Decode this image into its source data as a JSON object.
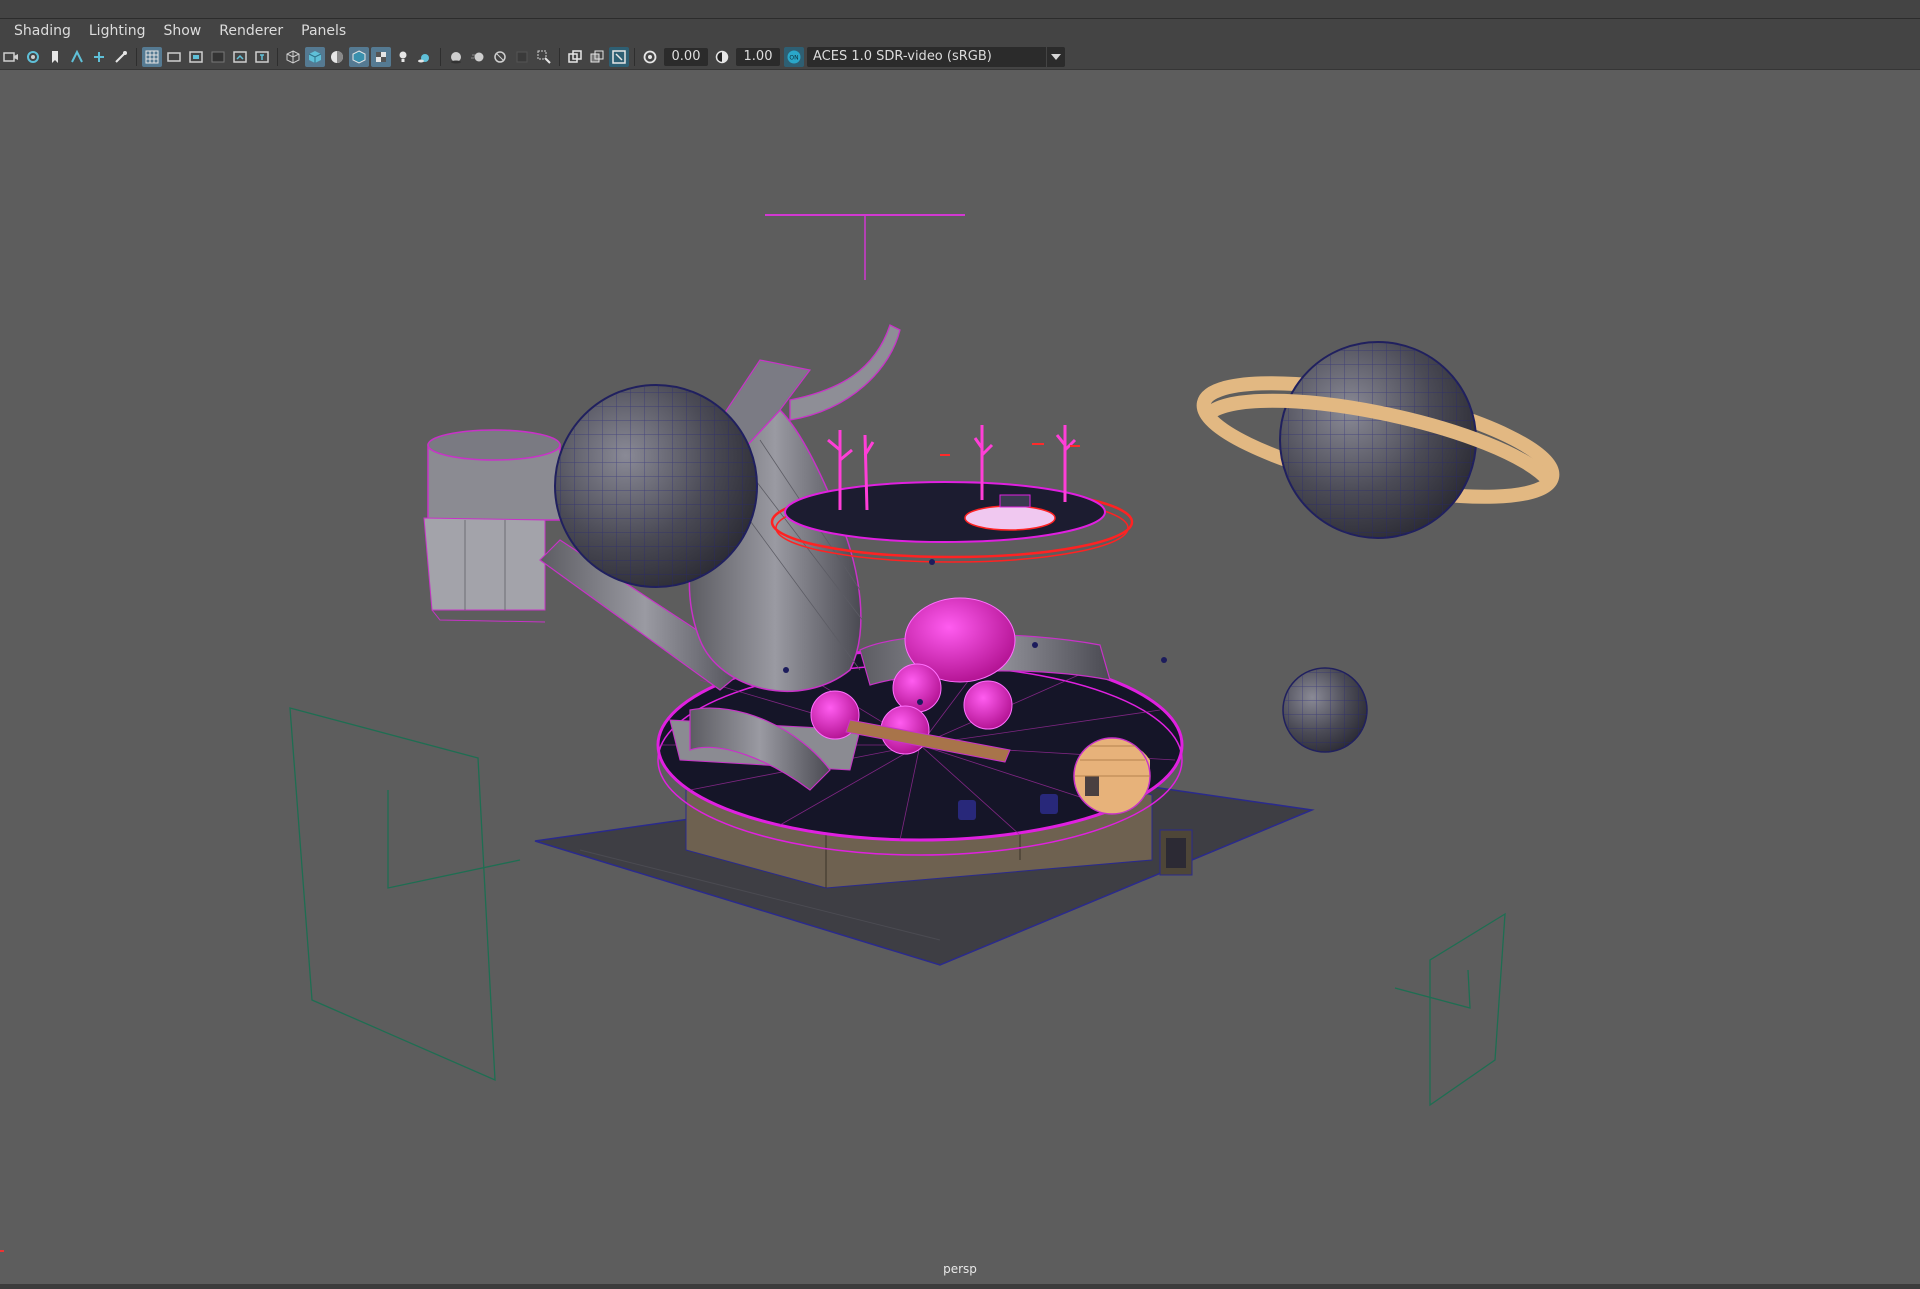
{
  "menu": {
    "items": [
      "Shading",
      "Lighting",
      "Show",
      "Renderer",
      "Panels"
    ]
  },
  "toolbar": {
    "icons_group1": [
      "camera-select-icon",
      "camera-attributes-icon",
      "bookmark-icon",
      "image-plane-icon",
      "grease-pencil-icon",
      "2d-pan-zoom-icon"
    ],
    "icons_group2": [
      "grid-icon",
      "film-gate-icon",
      "resolution-gate-icon",
      "gate-mask-icon",
      "field-chart-icon",
      "safe-action-icon"
    ],
    "icons_group3": [
      "wireframe-icon",
      "smooth-shade-icon",
      "default-material-icon",
      "wireframe-on-shaded-icon",
      "textured-icon",
      "use-all-lights-icon",
      "shadows-icon"
    ],
    "icons_group4": [
      "screen-space-ao-icon",
      "motion-blur-icon",
      "multisample-aa-icon",
      "depth-of-field-icon",
      "isolate-select-icon"
    ],
    "icons_group5": [
      "xray-icon",
      "xray-active-components-icon",
      "xray-joints-icon"
    ],
    "exposure_value": "0.00",
    "gamma_value": "1.00",
    "color_management_badge": "ON",
    "view_transform": "ACES 1.0 SDR-video (sRGB)"
  },
  "viewport": {
    "camera_label": "persp"
  },
  "colors": {
    "viewport_bg": "#5d5d5d",
    "selection_magenta": "#e020e0",
    "wire_blue": "#2a2a8c",
    "accent_cyan": "#2aa7c9"
  }
}
